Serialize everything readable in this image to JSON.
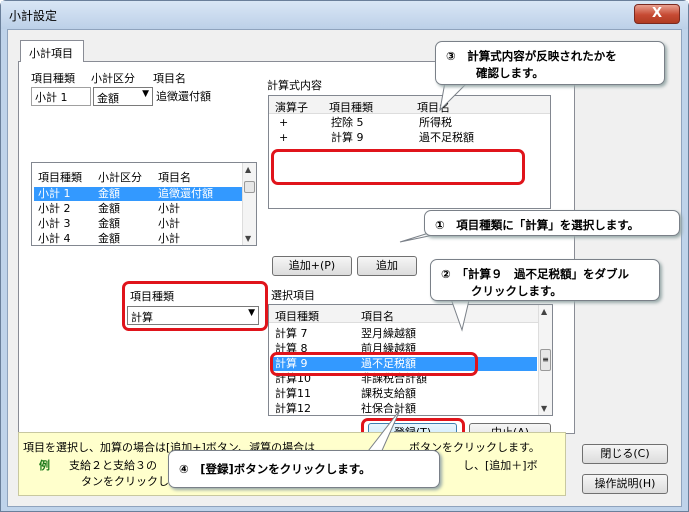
{
  "window": {
    "title": "小計設定",
    "close_glyph": "X"
  },
  "tab": {
    "label": "小計項目"
  },
  "top_fields": {
    "col_headers": [
      "項目種類",
      "小計区分",
      "項目名"
    ],
    "kind_value": "小計 1",
    "division_value": "金額",
    "name_value": "追徴還付額"
  },
  "formula": {
    "section_label": "計算式内容",
    "headers": [
      "演算子",
      "項目種類",
      "項目名"
    ],
    "rows": [
      {
        "op": "+",
        "kind": "控除 5",
        "name": "所得税"
      },
      {
        "op": "+",
        "kind": "計算 9",
        "name": "過不足税額"
      }
    ]
  },
  "left_list": {
    "headers": [
      "項目種類",
      "小計区分",
      "項目名"
    ],
    "rows": [
      {
        "kind": "小計 1",
        "div": "金額",
        "name": "追徴還付額",
        "selected": true
      },
      {
        "kind": "小計 2",
        "div": "金額",
        "name": "小計"
      },
      {
        "kind": "小計 3",
        "div": "金額",
        "name": "小計"
      },
      {
        "kind": "小計 4",
        "div": "金額",
        "name": "小計"
      }
    ]
  },
  "buttons": {
    "add_plus": "追加+(P)",
    "add_minus": "追加",
    "register": "登録(T)",
    "cancel": "中止(A)",
    "close": "閉じる(C)",
    "manual": "操作説明(H)"
  },
  "item_kind": {
    "label": "項目種類",
    "value": "計算"
  },
  "select_items": {
    "label": "選択項目",
    "headers": [
      "項目種類",
      "項目名"
    ],
    "rows": [
      {
        "kind": "計算 7",
        "name": "翌月繰越額"
      },
      {
        "kind": "計算 8",
        "name": "前月繰越額"
      },
      {
        "kind": "計算 9",
        "name": "過不足税額",
        "selected": true
      },
      {
        "kind": "計算10",
        "name": "非課税合計額"
      },
      {
        "kind": "計算11",
        "name": "課税支給額"
      },
      {
        "kind": "計算12",
        "name": "社保合計額"
      }
    ]
  },
  "hint": {
    "line1": "項目を選択し、加算の場合は[追加+]ボタン、減算の場合は",
    "line1b": "ボタンをクリックします。",
    "example_label": "例",
    "line2": "支給２と支給３の",
    "line2b": "し、[追加＋]ボ",
    "line3": "タンをクリックし"
  },
  "callouts": {
    "c1": "①　項目種類に「計算」を選択します。",
    "c2a": "②　「計算９　過不足税額」をダブル",
    "c2b": "クリックします。",
    "c3a": "③　計算式内容が反映されたかを",
    "c3b": "確認します。",
    "c4": "④　[登録]ボタンをクリックします。"
  }
}
